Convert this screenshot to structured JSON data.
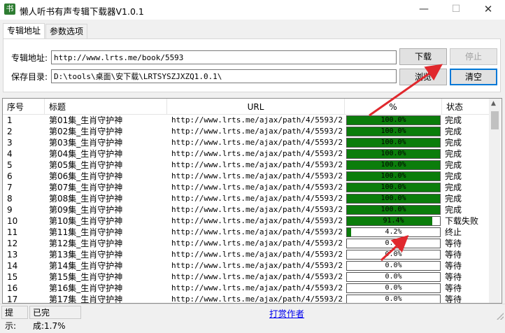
{
  "window": {
    "title": "懒人听书有声专辑下载器V1.0.1",
    "app_icon": "书",
    "minimize": "—",
    "maximize": "☐",
    "close": "✕"
  },
  "tabs": [
    {
      "label": "专辑地址",
      "active": true
    },
    {
      "label": "参数选项",
      "active": false
    }
  ],
  "form": {
    "album_label": "专辑地址:",
    "album_url": "http://www.lrts.me/book/5593",
    "save_label": "保存目录:",
    "save_dir": "D:\\tools\\桌面\\安下载\\LRTSYSZJXZQ1.0.1\\",
    "download_button": "下载",
    "stop_button": "停止",
    "browse_button": "浏览",
    "clear_button": "清空"
  },
  "table": {
    "columns": [
      "序号",
      "标题",
      "URL",
      "%",
      "状态"
    ],
    "rows": [
      {
        "index": "1",
        "title": "第01集_生肖守护神",
        "url": "http://www.lrts.me/ajax/path/4/5593/2...",
        "percent": 100.0,
        "percent_text": "100.0%",
        "status": "完成"
      },
      {
        "index": "2",
        "title": "第02集_生肖守护神",
        "url": "http://www.lrts.me/ajax/path/4/5593/2...",
        "percent": 100.0,
        "percent_text": "100.0%",
        "status": "完成"
      },
      {
        "index": "3",
        "title": "第03集_生肖守护神",
        "url": "http://www.lrts.me/ajax/path/4/5593/2...",
        "percent": 100.0,
        "percent_text": "100.0%",
        "status": "完成"
      },
      {
        "index": "4",
        "title": "第04集_生肖守护神",
        "url": "http://www.lrts.me/ajax/path/4/5593/2...",
        "percent": 100.0,
        "percent_text": "100.0%",
        "status": "完成"
      },
      {
        "index": "5",
        "title": "第05集_生肖守护神",
        "url": "http://www.lrts.me/ajax/path/4/5593/2...",
        "percent": 100.0,
        "percent_text": "100.0%",
        "status": "完成"
      },
      {
        "index": "6",
        "title": "第06集_生肖守护神",
        "url": "http://www.lrts.me/ajax/path/4/5593/2...",
        "percent": 100.0,
        "percent_text": "100.0%",
        "status": "完成"
      },
      {
        "index": "7",
        "title": "第07集_生肖守护神",
        "url": "http://www.lrts.me/ajax/path/4/5593/2...",
        "percent": 100.0,
        "percent_text": "100.0%",
        "status": "完成"
      },
      {
        "index": "8",
        "title": "第08集_生肖守护神",
        "url": "http://www.lrts.me/ajax/path/4/5593/2...",
        "percent": 100.0,
        "percent_text": "100.0%",
        "status": "完成"
      },
      {
        "index": "9",
        "title": "第09集_生肖守护神",
        "url": "http://www.lrts.me/ajax/path/4/5593/2...",
        "percent": 100.0,
        "percent_text": "100.0%",
        "status": "完成"
      },
      {
        "index": "10",
        "title": "第10集_生肖守护神",
        "url": "http://www.lrts.me/ajax/path/4/5593/2...",
        "percent": 91.4,
        "percent_text": "91.4%",
        "status": "下载失败"
      },
      {
        "index": "11",
        "title": "第11集_生肖守护神",
        "url": "http://www.lrts.me/ajax/path/4/5593/2...",
        "percent": 4.2,
        "percent_text": "4.2%",
        "status": "终止"
      },
      {
        "index": "12",
        "title": "第12集_生肖守护神",
        "url": "http://www.lrts.me/ajax/path/4/5593/2...",
        "percent": 0.0,
        "percent_text": "0.0%",
        "status": "等待"
      },
      {
        "index": "13",
        "title": "第13集_生肖守护神",
        "url": "http://www.lrts.me/ajax/path/4/5593/2...",
        "percent": 0.0,
        "percent_text": "0.0%",
        "status": "等待"
      },
      {
        "index": "14",
        "title": "第14集_生肖守护神",
        "url": "http://www.lrts.me/ajax/path/4/5593/2...",
        "percent": 0.0,
        "percent_text": "0.0%",
        "status": "等待"
      },
      {
        "index": "15",
        "title": "第15集_生肖守护神",
        "url": "http://www.lrts.me/ajax/path/4/5593/2...",
        "percent": 0.0,
        "percent_text": "0.0%",
        "status": "等待"
      },
      {
        "index": "16",
        "title": "第16集_生肖守护神",
        "url": "http://www.lrts.me/ajax/path/4/5593/2...",
        "percent": 0.0,
        "percent_text": "0.0%",
        "status": "等待"
      },
      {
        "index": "17",
        "title": "第17集_生肖守护神",
        "url": "http://www.lrts.me/ajax/path/4/5593/2...",
        "percent": 0.0,
        "percent_text": "0.0%",
        "status": "等待"
      }
    ]
  },
  "statusbar": {
    "hint": "提示:",
    "progress": "已完成:1.7%",
    "donate": "打赏作者"
  },
  "colors": {
    "progress_fill": "#0b7d0b",
    "annotation_arrow": "#e0282d",
    "link": "#0000ee"
  }
}
